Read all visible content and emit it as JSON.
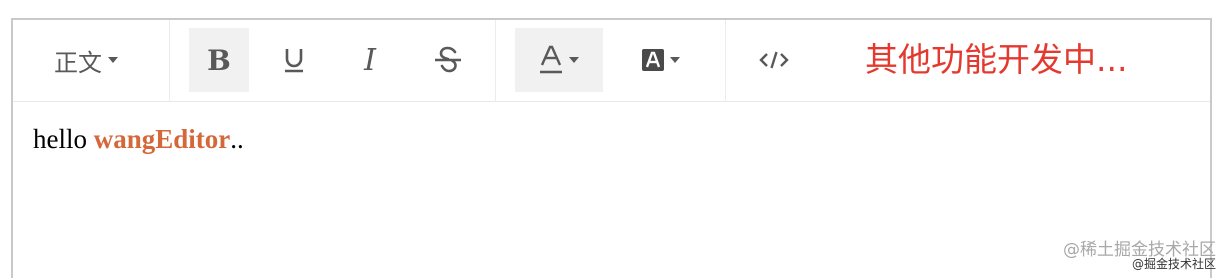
{
  "toolbar": {
    "heading_label": "正文",
    "notice": "其他功能开发中...",
    "buttons": [
      {
        "name": "bold",
        "glyph": "B",
        "active": true
      },
      {
        "name": "underline",
        "glyph": "U"
      },
      {
        "name": "italic",
        "glyph": "I"
      },
      {
        "name": "strikethrough",
        "glyph": "S"
      },
      {
        "name": "font-color",
        "glyph": "A",
        "active": true
      },
      {
        "name": "background-color",
        "glyph": "A"
      },
      {
        "name": "code",
        "glyph": "</>"
      }
    ]
  },
  "content": {
    "text_before": "hello ",
    "highlight": "wangEditor",
    "text_after": "..",
    "highlight_color": "#d4683a"
  },
  "colors": {
    "notice": "#e4392f",
    "icon": "#595959",
    "active_bg": "#f1f1f1"
  },
  "watermark": {
    "main": "@稀土掘金技术社区",
    "small": "@掘金技术社区"
  }
}
